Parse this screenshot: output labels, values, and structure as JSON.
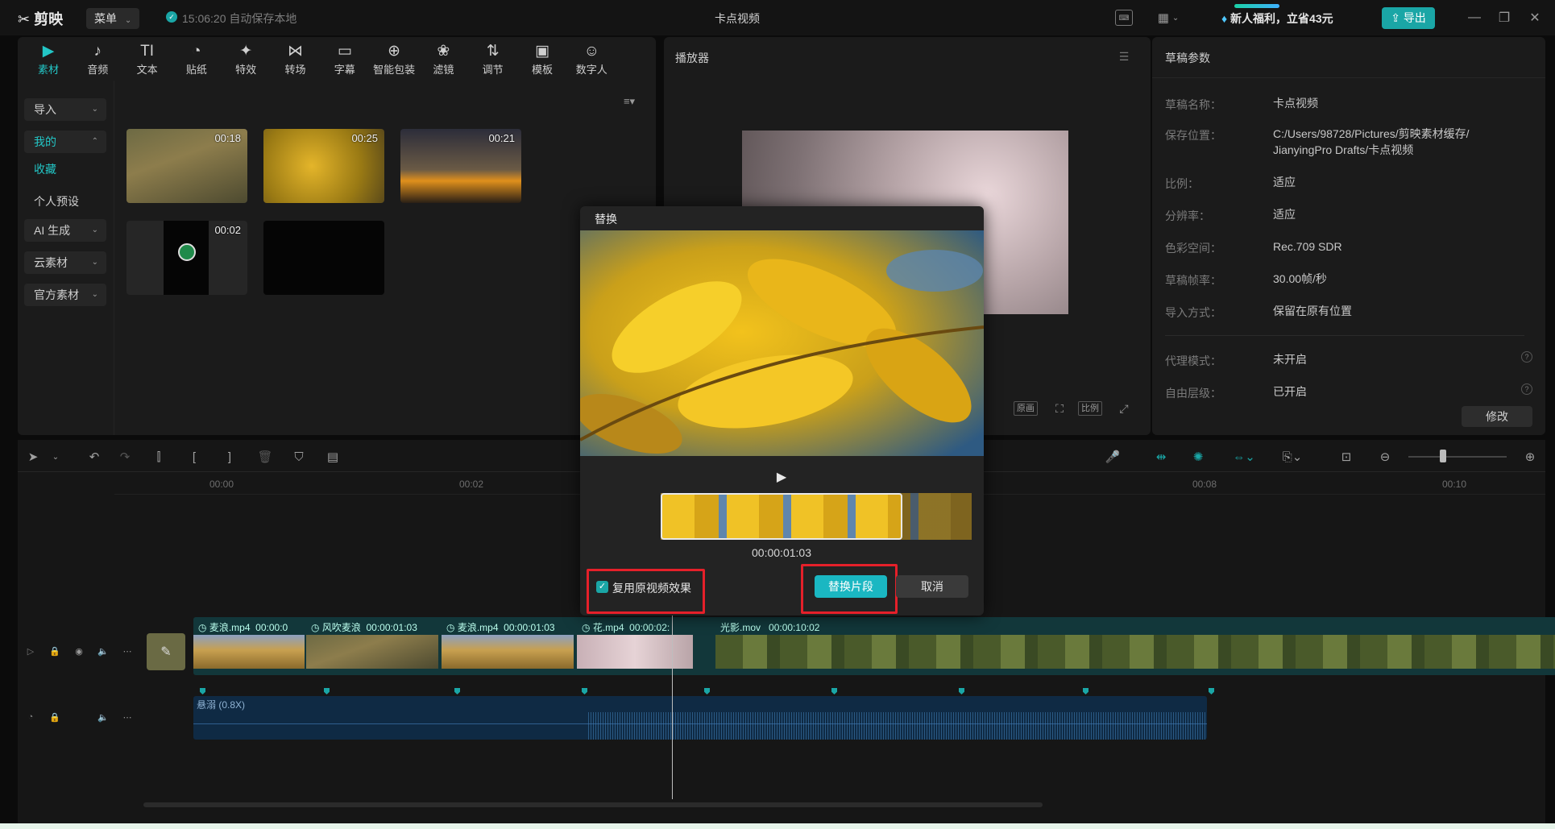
{
  "titlebar": {
    "logo": "剪映",
    "menu": "菜单",
    "autosave": "15:06:20 自动保存本地",
    "title": "卡点视频",
    "promo": "新人福利，立省43元",
    "export": "导出"
  },
  "toolbar_tabs": [
    {
      "label": "素材",
      "icon": "▶",
      "active": true
    },
    {
      "label": "音频",
      "icon": "♪"
    },
    {
      "label": "文本",
      "icon": "TI"
    },
    {
      "label": "贴纸",
      "icon": "◔"
    },
    {
      "label": "特效",
      "icon": "✦"
    },
    {
      "label": "转场",
      "icon": "⋈"
    },
    {
      "label": "字幕",
      "icon": "▭"
    },
    {
      "label": "智能包装",
      "icon": "⊕"
    },
    {
      "label": "滤镜",
      "icon": "❀"
    },
    {
      "label": "调节",
      "icon": "⇅"
    },
    {
      "label": "模板",
      "icon": "▣"
    },
    {
      "label": "数字人",
      "icon": "☺"
    }
  ],
  "sidebar": {
    "import": "导入",
    "mine": "我的",
    "favorites": "收藏",
    "presets": "个人预设",
    "ai": "AI 生成",
    "cloud": "云素材",
    "official": "官方素材"
  },
  "media": [
    {
      "duration": "00:18"
    },
    {
      "duration": "00:25"
    },
    {
      "duration": "00:21"
    },
    {
      "duration": "00:02"
    },
    {
      "duration": ""
    }
  ],
  "player": {
    "title": "播放器",
    "btn_original": "原画",
    "btn_ratio": "比例"
  },
  "draft": {
    "title": "草稿参数",
    "rows": [
      {
        "label": "草稿名称：",
        "value": "卡点视频"
      },
      {
        "label": "保存位置：",
        "value": "C:/Users/98728/Pictures/剪映素材缓存/ JianyingPro Drafts/卡点视频"
      },
      {
        "label": "比例：",
        "value": "适应"
      },
      {
        "label": "分辨率：",
        "value": "适应"
      },
      {
        "label": "色彩空间：",
        "value": "Rec.709 SDR"
      },
      {
        "label": "草稿帧率：",
        "value": "30.00帧/秒"
      },
      {
        "label": "导入方式：",
        "value": "保留在原有位置"
      },
      {
        "label": "代理模式：",
        "value": "未开启"
      },
      {
        "label": "自由层级：",
        "value": "已开启"
      }
    ],
    "modify": "修改"
  },
  "timeline": {
    "ruler": [
      "00:00",
      "00:02",
      "00:08",
      "00:10"
    ],
    "clips": [
      {
        "name": "麦浪.mp4",
        "time": "00:00:0"
      },
      {
        "name": "风吹麦浪",
        "time": "00:00:01:03"
      },
      {
        "name": "麦浪.mp4",
        "time": "00:00:01:03"
      },
      {
        "name": "花.mp4",
        "time": "00:00:02:"
      },
      {
        "name": "光影.mov",
        "time": "00:00:10:02"
      }
    ],
    "audio": "悬溺 (0.8X)"
  },
  "dialog": {
    "title": "替换",
    "timecode": "00:00:01:03",
    "reuse_label": "复用原视频效果",
    "replace_btn": "替换片段",
    "cancel_btn": "取消"
  }
}
